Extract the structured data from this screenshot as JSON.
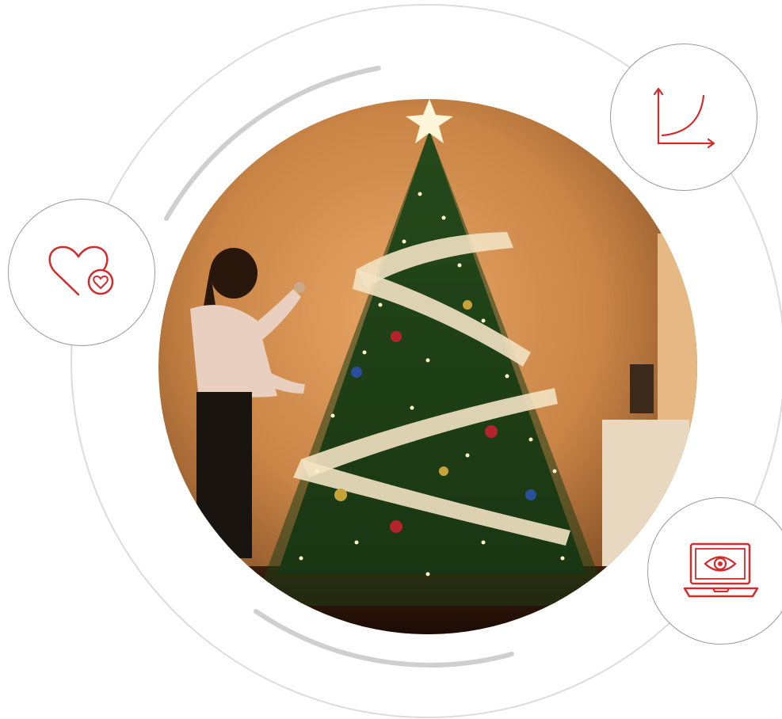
{
  "scene": {
    "photo_subject": "christmas-tree-photo",
    "accent_color": "#d42a2a",
    "ring_color": "#dcdcdc",
    "arc_color": "#cfcfcf",
    "badge_border_color": "#9a9a9a"
  },
  "badges": [
    {
      "icon": "heart-icon"
    },
    {
      "icon": "growth-chart-icon"
    },
    {
      "icon": "laptop-eye-icon"
    }
  ]
}
